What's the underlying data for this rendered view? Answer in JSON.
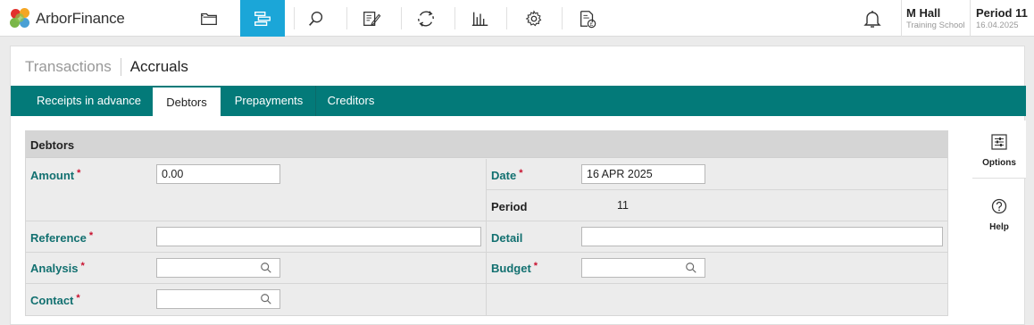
{
  "app": {
    "name": "ArborFinance"
  },
  "nav": {
    "icons": [
      "folder-icon",
      "transactions-icon",
      "search-icon",
      "edit-document-icon",
      "refresh-cycle-icon",
      "bar-chart-icon",
      "settings-icon",
      "pound-document-icon"
    ],
    "active": "transactions-icon"
  },
  "user": {
    "name": "M Hall",
    "school": "Training School"
  },
  "period": {
    "label": "Period 11",
    "date": "16.04.2025"
  },
  "breadcrumb": {
    "parent": "Transactions",
    "current": "Accruals"
  },
  "tabs": [
    {
      "label": "Receipts in advance",
      "active": false
    },
    {
      "label": "Debtors",
      "active": true
    },
    {
      "label": "Prepayments",
      "active": false
    },
    {
      "label": "Creditors",
      "active": false
    }
  ],
  "form": {
    "title": "Debtors",
    "amount": {
      "label": "Amount",
      "value": "0.00"
    },
    "date": {
      "label": "Date",
      "value": "16 APR 2025"
    },
    "period": {
      "label": "Period",
      "value": "11"
    },
    "reference": {
      "label": "Reference",
      "value": ""
    },
    "detail": {
      "label": "Detail",
      "value": ""
    },
    "analysis": {
      "label": "Analysis",
      "value": ""
    },
    "budget": {
      "label": "Budget",
      "value": ""
    },
    "contact": {
      "label": "Contact",
      "value": ""
    },
    "required_marker": "*"
  },
  "side": {
    "options": "Options",
    "help": "Help"
  },
  "colors": {
    "accent": "#1ba6d8",
    "tabbar": "#037a79",
    "label": "#127070",
    "required": "#c8102e"
  }
}
